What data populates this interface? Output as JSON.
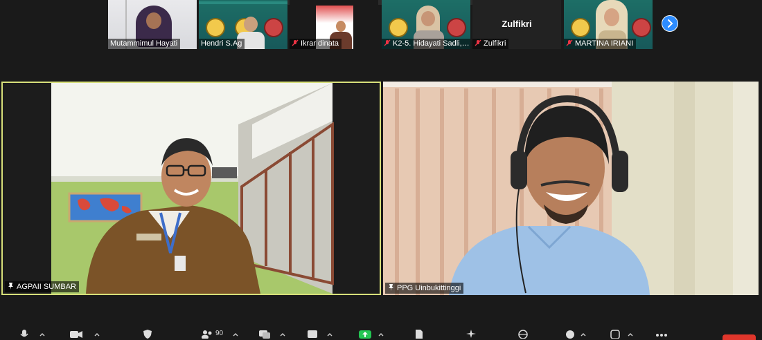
{
  "participants_strip": [
    {
      "name": "Mutammimul Hayati",
      "muted": false
    },
    {
      "name": "Hendri S.Ag",
      "muted": false
    },
    {
      "name": "Ikrar dinata",
      "muted": true
    },
    {
      "name": "K2-5. Hidayati Sadli, ...",
      "muted": true
    },
    {
      "name": "Zulfikri",
      "muted": true,
      "display_text": "Zulfikri"
    },
    {
      "name": "MARTINA IRIANI",
      "muted": true
    }
  ],
  "main_tiles": {
    "left": {
      "name": "AGPAII SUMBAR",
      "active_speaker": true
    },
    "right": {
      "name": "PPG Uinbukittinggi"
    }
  },
  "toolbar": {
    "participants_count": "90"
  },
  "colors": {
    "active_border": "#d7e07a",
    "accent_blue": "#2d8cff",
    "end_red": "#e0362b",
    "share_green": "#23c552"
  }
}
